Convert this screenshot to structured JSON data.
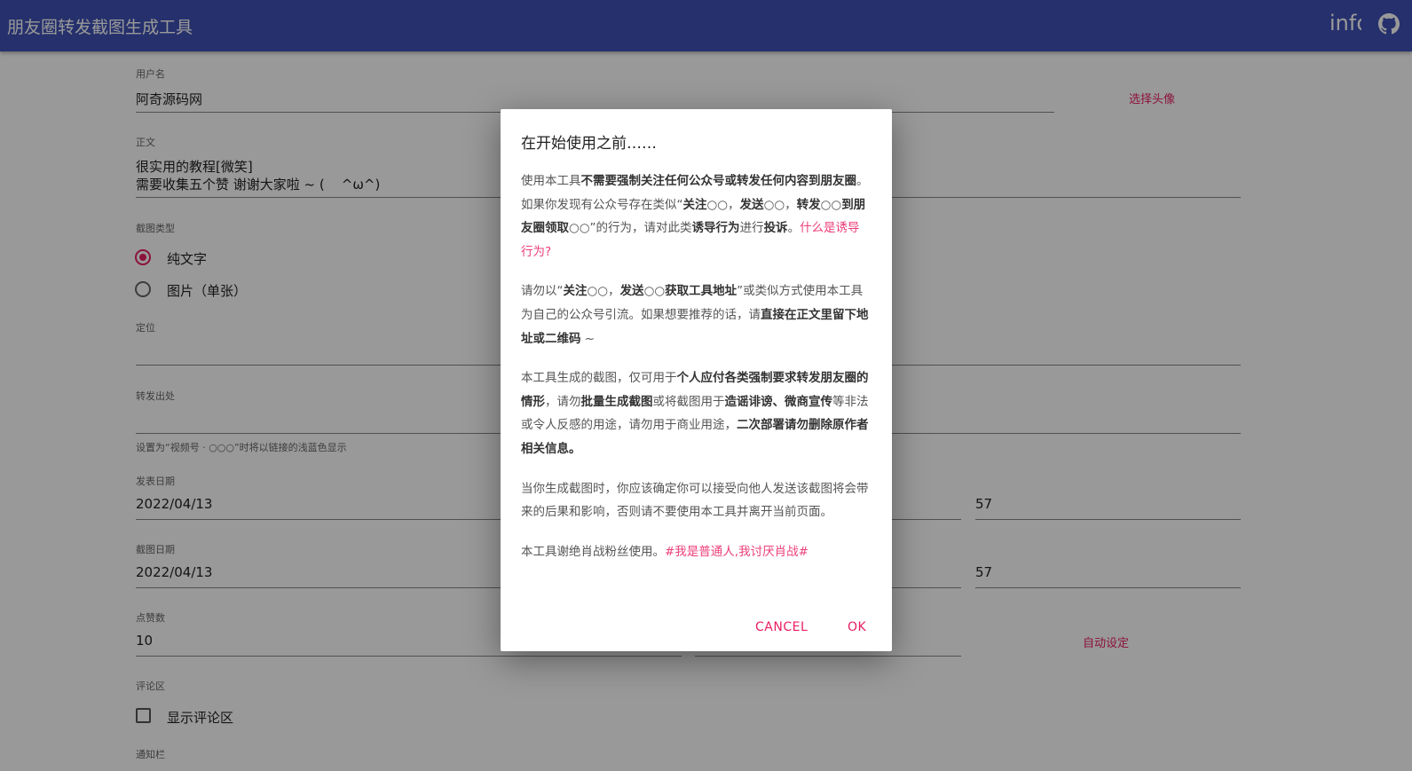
{
  "appbar": {
    "title": "朋友圈转发截图生成工具",
    "info": "info",
    "github_icon": "github-icon",
    "color": "#3f51b5"
  },
  "form": {
    "username": {
      "label": "用户名",
      "value": "阿奇源码网",
      "avatar_button": "选择头像"
    },
    "body": {
      "label": "正文",
      "line1": "很实用的教程[微笑]",
      "line2": "需要收集五个赞 谢谢大家啦 ~ (    ^ω^)"
    },
    "type": {
      "label": "截图类型",
      "options": [
        "纯文字",
        "图片（单张）"
      ],
      "selected": 0
    },
    "location": {
      "label": "定位",
      "value": ""
    },
    "source": {
      "label": "转发出处",
      "value": "",
      "hint": "设置为“视频号 · ○○○”时将以链接的浅蓝色显示"
    },
    "post_date": {
      "label": "发表日期",
      "date": "2022/04/13",
      "minute": "57"
    },
    "shot_date": {
      "label": "截图日期",
      "date": "2022/04/13",
      "minute": "57"
    },
    "likes": {
      "label": "点赞数",
      "value": "10",
      "auto_button": "自动设定"
    },
    "comments": {
      "label": "评论区",
      "checkbox": "显示评论区",
      "checked": false
    },
    "notify": {
      "label": "通知栏"
    }
  },
  "dialog": {
    "title": "在开始使用之前……",
    "paragraphs": [
      [
        {
          "t": "使用本工具"
        },
        {
          "t": "不需要强制关注任何公众号或转发任何内容到朋友圈",
          "b": 1
        },
        {
          "t": "。如果你发现有公众号存在类似“"
        },
        {
          "t": "关注",
          "b": 1
        },
        {
          "t": "○○，"
        },
        {
          "t": "发送",
          "b": 1
        },
        {
          "t": "○○，"
        },
        {
          "t": "转发",
          "b": 1
        },
        {
          "t": "○○"
        },
        {
          "t": "到朋友圈领取",
          "b": 1
        },
        {
          "t": "○○”的行为，请对此类"
        },
        {
          "t": "诱导行为",
          "b": 1
        },
        {
          "t": "进行"
        },
        {
          "t": "投诉",
          "b": 1
        },
        {
          "t": "。"
        },
        {
          "t": "什么是诱导行为?",
          "l": 1
        }
      ],
      [
        {
          "t": "请勿以“"
        },
        {
          "t": "关注",
          "b": 1
        },
        {
          "t": "○○，"
        },
        {
          "t": "发送",
          "b": 1
        },
        {
          "t": "○○"
        },
        {
          "t": "获取工具地址",
          "b": 1
        },
        {
          "t": "”或类似方式使用本工具为自己的公众号引流。如果想要推荐的话，请"
        },
        {
          "t": "直接在正文里留下地址或二维码",
          "b": 1
        },
        {
          "t": " ~"
        }
      ],
      [
        {
          "t": "本工具生成的截图，仅可用于"
        },
        {
          "t": "个人应付各类强制要求转发朋友圈的情形",
          "b": 1
        },
        {
          "t": "，请勿"
        },
        {
          "t": "批量生成截图",
          "b": 1
        },
        {
          "t": "或将截图用于"
        },
        {
          "t": "造谣诽谤、微商宣传",
          "b": 1
        },
        {
          "t": "等非法或令人反感的用途，请勿用于商业用途，"
        },
        {
          "t": "二次部署请勿删除原作者相关信息。",
          "b": 1
        }
      ],
      [
        {
          "t": "当你生成截图时，你应该确定你可以接受向他人发送该截图将会带来的后果和影响，否则请不要使用本工具并离开当前页面。"
        }
      ],
      [
        {
          "t": "本工具谢绝肖战粉丝使用。"
        },
        {
          "t": "#我是普通人,我讨厌肖战#",
          "l": 1
        }
      ]
    ],
    "cancel": "CANCEL",
    "ok": "OK"
  }
}
